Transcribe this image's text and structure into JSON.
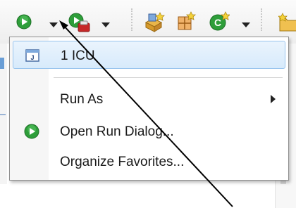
{
  "toolbar": {
    "buttons": [
      {
        "name": "run-button",
        "icon": "run-icon"
      },
      {
        "name": "run-dropdown-button",
        "icon": "chevron-down-icon"
      },
      {
        "name": "external-tools-button",
        "icon": "external-tools-icon"
      },
      {
        "name": "external-tools-dropdown-button",
        "icon": "chevron-down-icon"
      },
      {
        "name": "new-package-button",
        "icon": "new-package-icon"
      },
      {
        "name": "new-class-button",
        "icon": "new-class-icon"
      },
      {
        "name": "new-java-class-button",
        "icon": "new-java-class-icon"
      },
      {
        "name": "new-java-class-dropdown-button",
        "icon": "chevron-down-icon"
      },
      {
        "name": "open-folder-button",
        "icon": "folder-icon"
      }
    ]
  },
  "run_menu": {
    "items": [
      {
        "label": "1 ICU",
        "icon": "java-file-icon",
        "selected": true
      },
      {
        "label": "Run As",
        "has_submenu": true
      },
      {
        "label": "Open Run Dialog...",
        "icon": "run-icon"
      },
      {
        "label": "Organize Favorites..."
      }
    ]
  },
  "colors": {
    "run_green": "#2e9e3a",
    "selection_bg": "#d7eafb",
    "selection_border": "#99c4ee",
    "menu_border": "#8f8f8f",
    "arrow": "#000000"
  }
}
